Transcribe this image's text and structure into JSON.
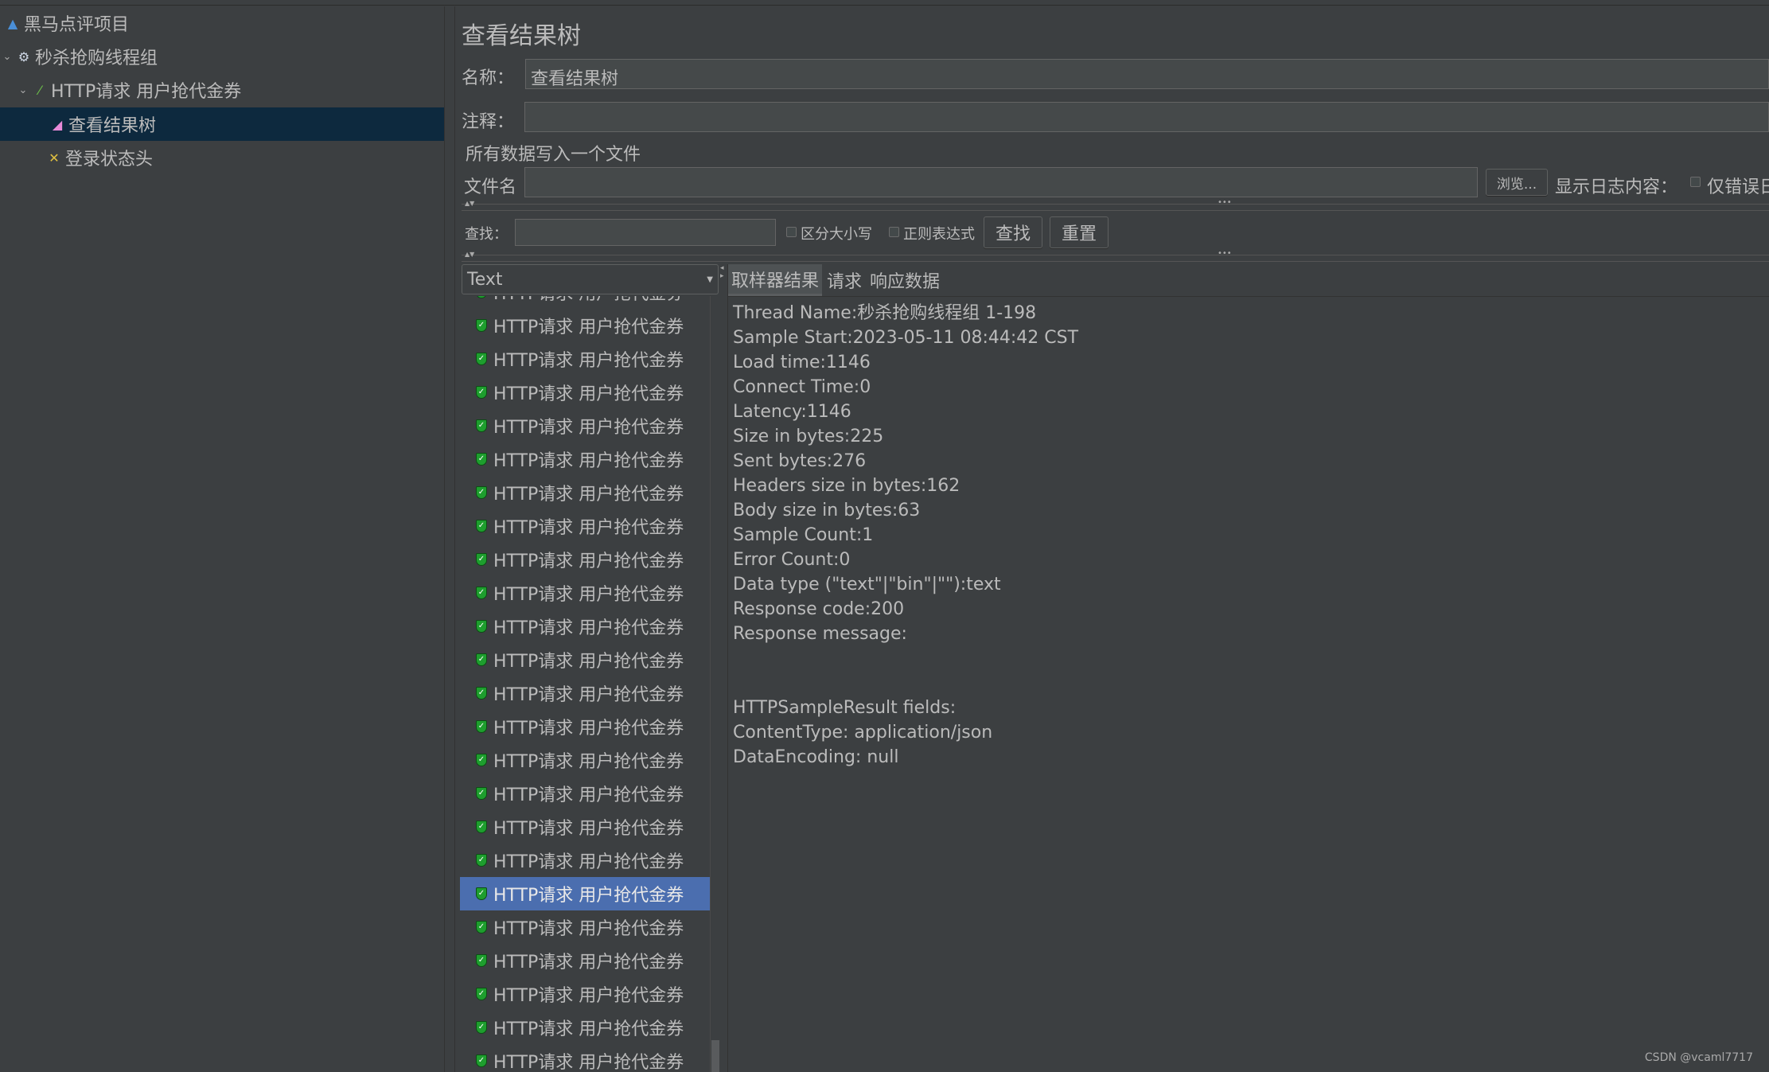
{
  "tree": [
    {
      "label": "黑马点评项目",
      "icon": "flask-icon"
    },
    {
      "label": "秒杀抢购线程组",
      "icon": "gear-icon"
    },
    {
      "label": "HTTP请求 用户抢代金券",
      "icon": "pipette-icon"
    },
    {
      "label": "查看结果树",
      "icon": "chart-icon",
      "selected": true
    },
    {
      "label": "登录状态头",
      "icon": "wrench-icon"
    }
  ],
  "panel": {
    "title": "查看结果树",
    "name_label": "名称：",
    "name_value": "查看结果树",
    "comment_label": "注释：",
    "comment_value": "",
    "file_section": "所有数据写入一个文件",
    "filename_label": "文件名",
    "filename_value": "",
    "browse": "浏览...",
    "log_label": "显示日志内容：",
    "errors_only": "仅错误日",
    "search_label": "查找：",
    "search_value": "",
    "case_sensitive": "区分大小写",
    "regex": "正则表达式",
    "find_button": "查找",
    "reset_button": "重置"
  },
  "renderer": "Text",
  "results": {
    "item_label": "HTTP请求 用户抢代金券",
    "visible_count": 24,
    "selected_index": 18
  },
  "tabs": [
    "取样器结果",
    "请求",
    "响应数据"
  ],
  "active_tab": 0,
  "detail_lines": [
    "Thread Name:秒杀抢购线程组 1-198",
    "Sample Start:2023-05-11 08:44:42 CST",
    "Load time:1146",
    "Connect Time:0",
    "Latency:1146",
    "Size in bytes:225",
    "Sent bytes:276",
    "Headers size in bytes:162",
    "Body size in bytes:63",
    "Sample Count:1",
    "Error Count:0",
    "Data type (\"text\"|\"bin\"|\"\"):text",
    "Response code:200",
    "Response message:",
    "",
    "",
    "HTTPSampleResult fields:",
    "ContentType: application/json",
    "DataEncoding: null"
  ],
  "watermark": "CSDN @vcaml7717",
  "colors": {
    "bg": "#3c3f41",
    "text": "#bbbbbb",
    "tree_selected": "#0d293e",
    "list_selected": "#4b6eaf",
    "success": "#1e9e2e"
  }
}
